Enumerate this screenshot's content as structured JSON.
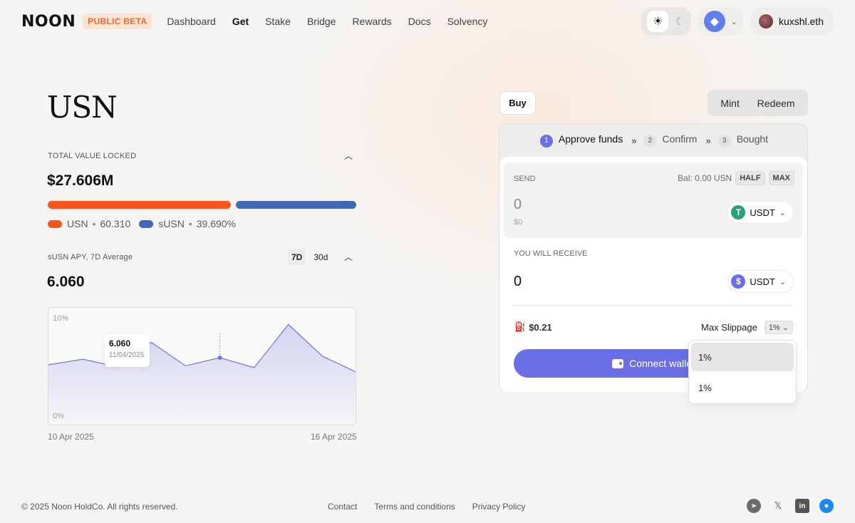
{
  "header": {
    "logo": "NOON",
    "badge": "PUBLIC BETA",
    "nav": [
      "Dashboard",
      "Get",
      "Stake",
      "Bridge",
      "Rewards",
      "Docs",
      "Solvency"
    ],
    "active_nav": "Get",
    "account": "kuxshl.eth"
  },
  "overview": {
    "title": "USN",
    "tvl_label": "TOTAL VALUE LOCKED",
    "tvl_value": "$27.606M",
    "split": {
      "usn_label": "USN",
      "usn_pct": "60.310",
      "usn_fraction": 0.6031,
      "susn_label": "sUSN",
      "susn_pct": "39.690%",
      "susn_fraction": 0.3969,
      "bullet": "•"
    },
    "apy_label": "sUSN APY, 7D  Average",
    "ranges": [
      "7D",
      "30d"
    ],
    "selected_range": "7D",
    "apy_value": "6.060"
  },
  "chart_data": {
    "type": "area",
    "x": [
      "10 Apr 2025",
      "",
      "",
      "",
      "",
      "",
      "",
      "",
      "",
      "",
      "16 Apr 2025"
    ],
    "values": [
      5.3,
      5.9,
      5.1,
      7.7,
      5.2,
      6.06,
      5.0,
      9.6,
      6.2,
      4.5
    ],
    "ylim": [
      0,
      10
    ],
    "y_ticks": [
      "10%",
      "0%"
    ],
    "x_start_label": "10 Apr 2025",
    "x_end_label": "16 Apr 2025",
    "tooltip": {
      "value": "6.060",
      "date": "11/04/2025",
      "index": 5
    },
    "color": "#7073e0"
  },
  "swap": {
    "buy_tab": "Buy",
    "modes": [
      "Mint",
      "Redeem"
    ],
    "steps": [
      {
        "num": "1",
        "label": "Approve funds"
      },
      {
        "num": "2",
        "label": "Confirm"
      },
      {
        "num": "3",
        "label": "Bought"
      }
    ],
    "step_arrow": "»",
    "send_label": "SEND",
    "balance": "Bal: 0.00 USN",
    "half": "HALF",
    "max": "MAX",
    "send_amount": "0",
    "send_usd": "$0",
    "send_token": "USDT",
    "receive_label": "YOU WILL RECEIVE",
    "receive_amount": "0",
    "receive_token": "USDT",
    "gas": "$0.21",
    "slippage_label": "Max Slippage",
    "slippage_value": "1%",
    "connect": "Connect wallet",
    "dropdown_options": [
      "1%",
      "1%"
    ]
  },
  "footer": {
    "copyright": "© 2025 Noon HoldCo. All rights reserved.",
    "links": [
      "Contact",
      "Terms and conditions",
      "Privacy Policy"
    ]
  },
  "colors": {
    "usn": "#fa541c",
    "susn": "#4467b5",
    "accent": "#6b6fe6",
    "usdt": "#26a17b"
  }
}
